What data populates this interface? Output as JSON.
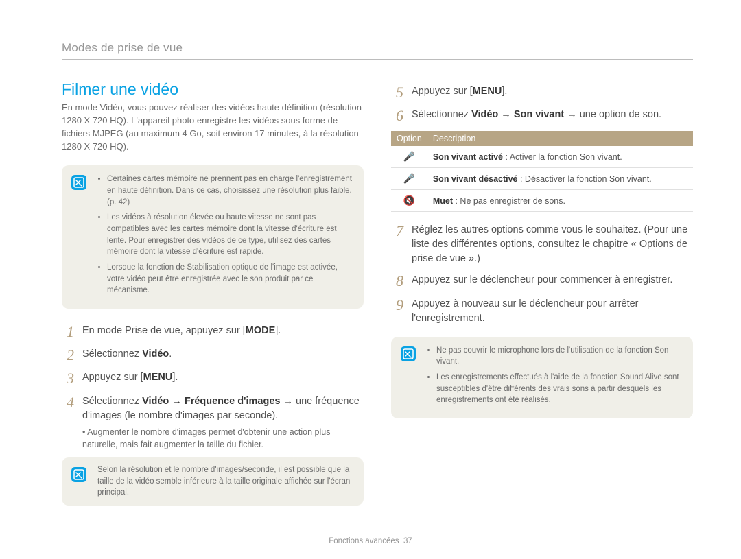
{
  "kicker": "Modes de prise de vue",
  "left": {
    "title": "Filmer une vidéo",
    "intro": "En mode Vidéo, vous pouvez réaliser des vidéos haute définition (résolution 1280 X 720 HQ). L'appareil photo enregistre les vidéos sous forme de fichiers MJPEG (au maximum 4 Go, soit environ 17 minutes, à la résolution 1280 X 720 HQ).",
    "notebox1": {
      "items": [
        "Certaines cartes mémoire ne prennent pas en charge l'enregistrement en haute définition. Dans ce cas, choisissez une résolution plus faible. (p. 42)",
        "Les vidéos à résolution élevée ou haute vitesse ne sont pas compatibles avec les cartes mémoire dont la vitesse d'écriture est lente. Pour enregistrer des vidéos de ce type, utilisez des cartes mémoire dont la vitesse d'écriture est rapide.",
        "Lorsque la fonction de Stabilisation optique de l'image est activée, votre vidéo peut être enregistrée avec le son produit par ce mécanisme."
      ]
    },
    "steps": {
      "s1_pre": "En mode Prise de vue, appuyez sur [",
      "s1_kbd": "MODE",
      "s1_post": "].",
      "s2_pre": "Sélectionnez ",
      "s2_bold": "Vidéo",
      "s2_post": ".",
      "s3_pre": "Appuyez sur [",
      "s3_kbd": "MENU",
      "s3_post": "].",
      "s4_pre": "Sélectionnez ",
      "s4_bold": "Vidéo → Fréquence d'images",
      "s4_post": " → une fréquence d'images (le nombre d'images par seconde).",
      "s4_sub": "Augmenter le nombre d'images permet d'obtenir une action plus naturelle, mais fait augmenter la taille du fichier."
    },
    "notebox2": "Selon la résolution et le nombre d'images/seconde, il est possible que la taille de la vidéo semble inférieure à la taille originale affichée sur l'écran principal."
  },
  "right": {
    "steps_a": {
      "s5_pre": "Appuyez sur [",
      "s5_kbd": "MENU",
      "s5_post": "].",
      "s6_pre": "Sélectionnez ",
      "s6_bold": "Vidéo → Son vivant",
      "s6_post": " → une option de son."
    },
    "table": {
      "h1": "Option",
      "h2": "Description",
      "rows": [
        {
          "icon": "🎤",
          "label": "Son vivant activé",
          "desc": " : Activer la fonction Son vivant."
        },
        {
          "icon": "🎤̶",
          "label": "Son vivant désactivé",
          "desc": " : Désactiver la fonction Son vivant."
        },
        {
          "icon": "🔇",
          "label": "Muet",
          "desc": " : Ne pas enregistrer de sons."
        }
      ]
    },
    "steps_b": {
      "s7": "Réglez les autres options comme vous le souhaitez. (Pour une liste des différentes options, consultez le chapitre « Options de prise de vue ».)",
      "s8": "Appuyez sur le déclencheur pour commencer à enregistrer.",
      "s9": "Appuyez à nouveau sur le déclencheur pour arrêter l'enregistrement."
    },
    "notebox3": {
      "items": [
        "Ne pas couvrir le microphone lors de l'utilisation de la fonction Son vivant.",
        "Les enregistrements effectués à l'aide de la fonction Sound Alive sont susceptibles d'être différents des vrais sons à partir desquels les enregistrements ont été réalisés."
      ]
    }
  },
  "footer_label": "Fonctions avancées",
  "footer_page": "37"
}
